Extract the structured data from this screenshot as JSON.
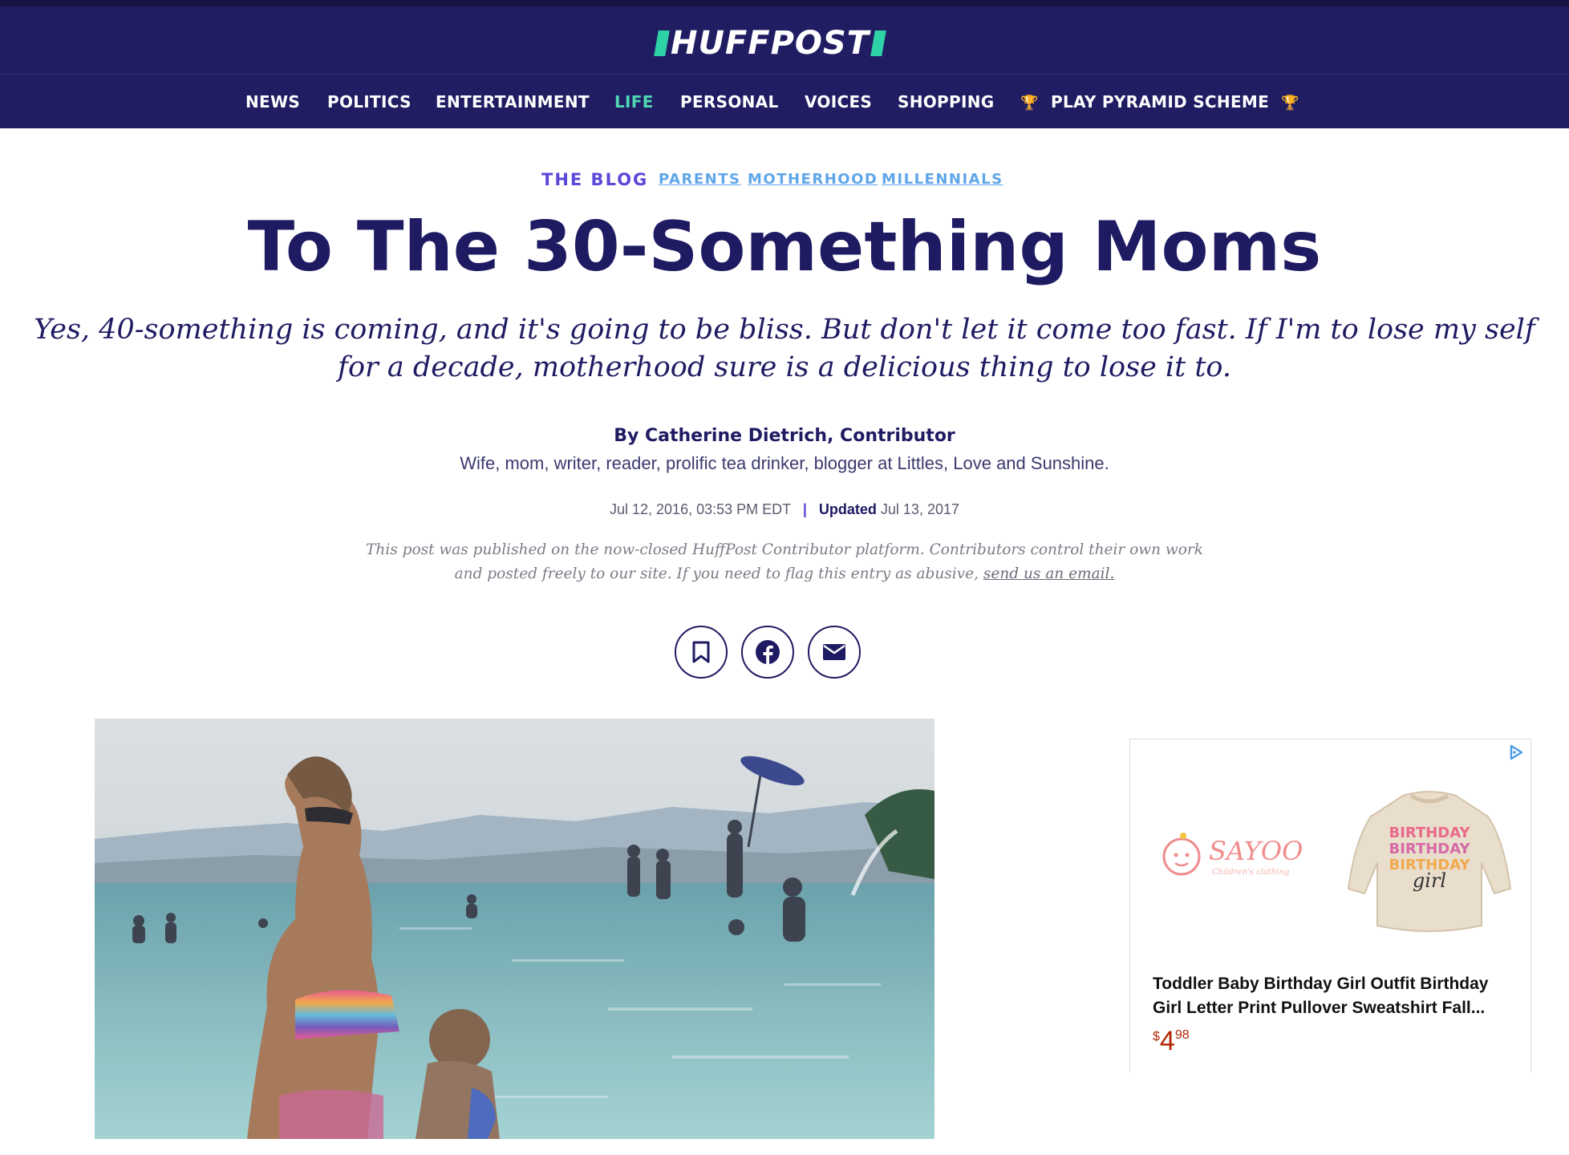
{
  "header": {
    "logo_text": "HUFFPOST",
    "brand_color": "#201d63",
    "accent_color": "#2fd1a6"
  },
  "nav": {
    "items": [
      {
        "label": "NEWS"
      },
      {
        "label": "POLITICS"
      },
      {
        "label": "ENTERTAINMENT"
      },
      {
        "label": "LIFE",
        "active": true
      },
      {
        "label": "PERSONAL"
      },
      {
        "label": "VOICES"
      },
      {
        "label": "SHOPPING"
      },
      {
        "label": "PLAY PYRAMID SCHEME",
        "icon": "trophy-icon"
      }
    ],
    "trophy_glyph": "🏆"
  },
  "article": {
    "section": "THE BLOG",
    "tags": [
      "PARENTS",
      "MOTHERHOOD",
      "MILLENNIALS"
    ],
    "title": "To The 30-Something Moms",
    "dek": "Yes, 40-something is coming, and it's going to be bliss. But don't let it come too fast. If I'm to lose my self for a decade, motherhood sure is a delicious thing to lose it to.",
    "byline": "By Catherine Dietrich, Contributor",
    "bio": "Wife, mom, writer, reader, prolific tea drinker, blogger at Littles, Love and Sunshine.",
    "published": "Jul 12, 2016, 03:53 PM EDT",
    "separator": "|",
    "updated_label": "Updated",
    "updated_date": "Jul 13, 2017",
    "notice_text": "This post was published on the now-closed HuffPost Contributor platform. Contributors control their own work and posted freely to our site. If you need to flag this entry as abusive,",
    "notice_link": "send us an email.",
    "share_buttons": [
      "bookmark-icon",
      "facebook-icon",
      "email-icon"
    ]
  },
  "ad": {
    "brand_name": "SAYOO",
    "brand_tagline": "Children's clothing",
    "sweater_text_1": "BIRTHDAY",
    "sweater_text_2": "girl",
    "product_title": "Toddler Baby Birthday Girl Outfit Birthday Girl Letter Print Pullover Sweatshirt Fall...",
    "price_currency": "$",
    "price_whole": "4",
    "price_fraction": "98",
    "price_color": "#b12704"
  }
}
